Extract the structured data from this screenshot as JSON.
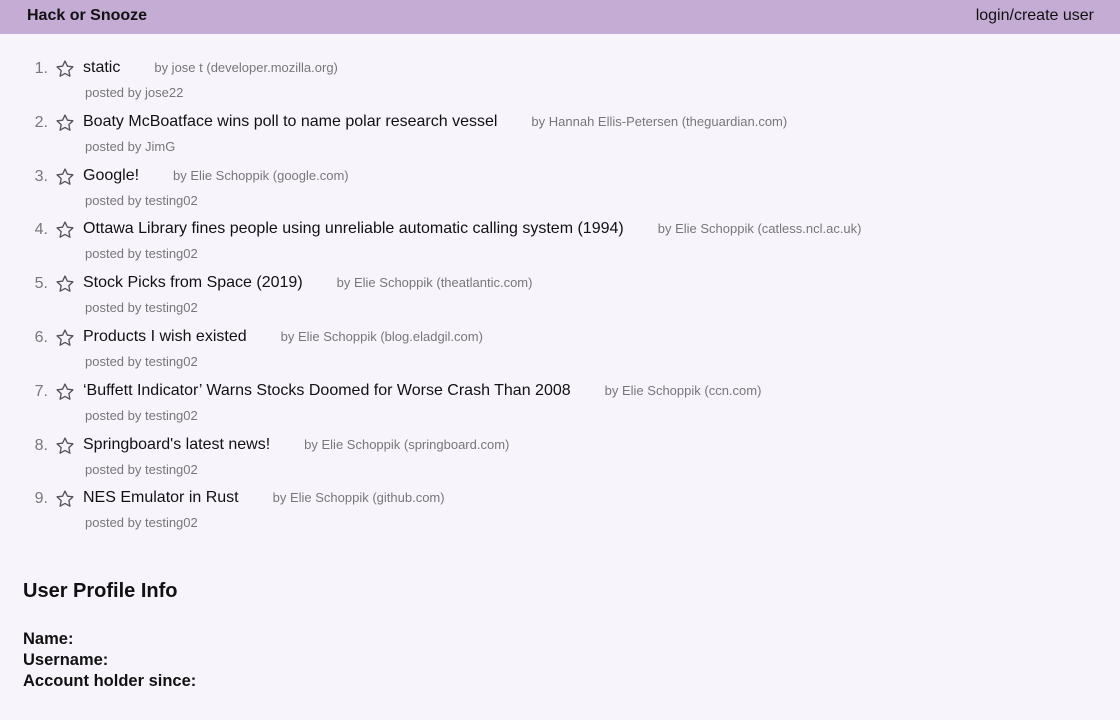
{
  "navbar": {
    "brand": "Hack or Snooze",
    "login_label": "login/create user"
  },
  "stories": [
    {
      "num": "1.",
      "title": "static",
      "author": "by jose t (developer.mozilla.org)",
      "poster": "posted by jose22"
    },
    {
      "num": "2.",
      "title": "Boaty McBoatface wins poll to name polar research vessel",
      "author": "by Hannah Ellis-Petersen (theguardian.com)",
      "poster": "posted by JimG"
    },
    {
      "num": "3.",
      "title": "Google!",
      "author": "by Elie Schoppik (google.com)",
      "poster": "posted by testing02"
    },
    {
      "num": "4.",
      "title": "Ottawa Library fines people using unreliable automatic calling system (1994)",
      "author": "by Elie Schoppik (catless.ncl.ac.uk)",
      "poster": "posted by testing02"
    },
    {
      "num": "5.",
      "title": "Stock Picks from Space (2019)",
      "author": "by Elie Schoppik (theatlantic.com)",
      "poster": "posted by testing02"
    },
    {
      "num": "6.",
      "title": "Products I wish existed",
      "author": "by Elie Schoppik (blog.eladgil.com)",
      "poster": "posted by testing02"
    },
    {
      "num": "7.",
      "title": "‘Buffett Indicator’ Warns Stocks Doomed for Worse Crash Than 2008",
      "author": "by Elie Schoppik (ccn.com)",
      "poster": "posted by testing02"
    },
    {
      "num": "8.",
      "title": "Springboard's latest news!",
      "author": "by Elie Schoppik (springboard.com)",
      "poster": "posted by testing02"
    },
    {
      "num": "9.",
      "title": "NES Emulator in Rust",
      "author": "by Elie Schoppik (github.com)",
      "poster": "posted by testing02"
    }
  ],
  "profile": {
    "heading": "User Profile Info",
    "name_label": "Name:",
    "username_label": "Username:",
    "since_label": "Account holder since:"
  },
  "colors": {
    "navbar_bg": "#c4acd4",
    "page_bg": "#f8f4fc",
    "muted_text": "#777777"
  }
}
